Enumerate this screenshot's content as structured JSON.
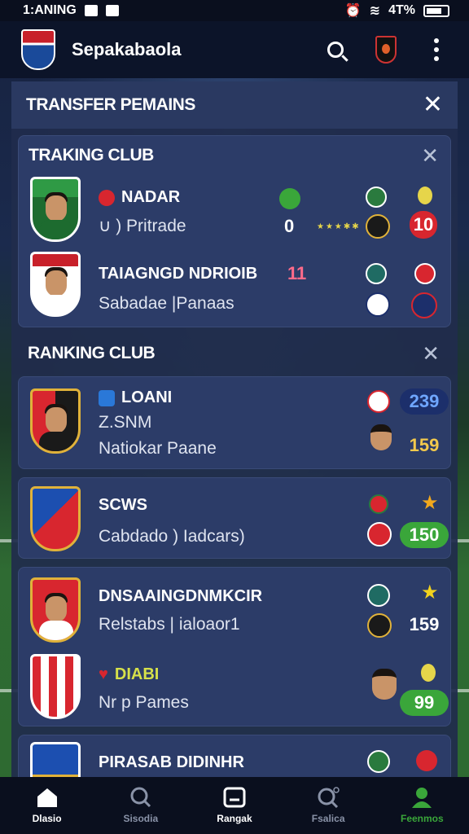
{
  "status_bar": {
    "time": "1:ANING",
    "battery": "4T%"
  },
  "app_bar": {
    "title": "Sepakabaola"
  },
  "panel": {
    "title": "TRANSFER PEMAINS",
    "tracking": {
      "title": "TRAKING CLUB",
      "rows": [
        {
          "name": "NADAR",
          "subtitle": "∪ ) Pritrade",
          "value": "0",
          "stars": "★★★✱✱",
          "badge": "10",
          "extra": ""
        },
        {
          "name": "TAIAGNGD NDRIOIB",
          "subtitle": "Sabadae |Panaas",
          "value": "",
          "stars": "",
          "badge": "",
          "extra": "11"
        }
      ]
    },
    "ranking": {
      "title": "RANKING CLUB",
      "rows": [
        {
          "name": "LOANI",
          "subtitle1": "Z.SNM",
          "subtitle2": "Natiokar Paane",
          "score1": "239",
          "score2": "159"
        },
        {
          "name": "SCWS",
          "subtitle": "Cabdado ) Iadcars)",
          "score": "150"
        },
        {
          "name": "DNSAAINGDNMKCIR",
          "subtitle": "Relstabs | ialoaor1",
          "score": "159"
        },
        {
          "name": "DIABI",
          "subtitle": "Nr p Pames",
          "score": "99"
        },
        {
          "name": "PIRASAB DIDINHR"
        }
      ]
    }
  },
  "bottom_nav": [
    {
      "label": "Dlasio",
      "icon": "home-icon",
      "color": "#ffffff"
    },
    {
      "label": "Sisodia",
      "icon": "search-icon",
      "color": "#8a93a8"
    },
    {
      "label": "Rangak",
      "icon": "tv-icon",
      "color": "#ffffff"
    },
    {
      "label": "Fsalica",
      "icon": "search-alt-icon",
      "color": "#8a93a8"
    },
    {
      "label": "Feenmos",
      "icon": "profile-icon",
      "color": "#3aa63a"
    }
  ],
  "colors": {
    "accent_green": "#3aa63a",
    "badge_red": "#d8262f",
    "score_blue": "#1c2f6b"
  }
}
